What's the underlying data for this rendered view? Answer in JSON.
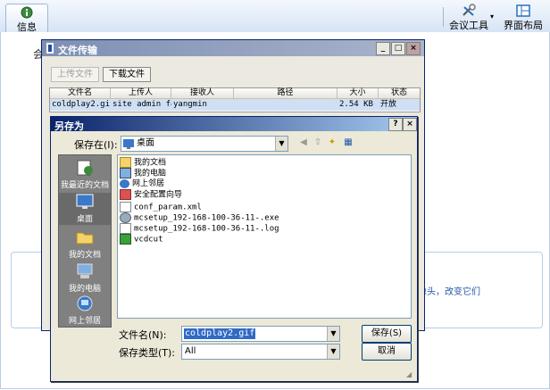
{
  "toolbar": {
    "info_tab": "信息",
    "tools": "会议工具",
    "layout": "界面布局"
  },
  "background": {
    "left_char": "会",
    "right_text": "像头，改变它们"
  },
  "file_transfer": {
    "title": "文件传输",
    "upload_button": "上传文件",
    "download_button": "下载文件",
    "columns": [
      "文件名",
      "上传人",
      "接收人",
      "路径",
      "大小",
      "状态"
    ],
    "rows": [
      [
        "coldplay2.gif",
        "site admin f4",
        "yangmin",
        "",
        "2.54 KB",
        "开放"
      ]
    ]
  },
  "save_dialog": {
    "title": "另存为",
    "help_button": "?",
    "close_button": "×",
    "save_in_label": "保存在(I):",
    "save_in_value": "桌面",
    "places": [
      "我最近的文档",
      "桌面",
      "我的文档",
      "我的电脑",
      "网上邻居"
    ],
    "files": [
      "我的文档",
      "我的电脑",
      "网上邻居",
      "安全配置向导",
      "conf_param.xml",
      "mcsetup_192-168-100-36-11-.exe",
      "mcsetup_192-168-100-36-11-.log",
      "vcdcut"
    ],
    "filename_label": "文件名(N):",
    "filename_value": "coldplay2.gif",
    "filetype_label": "保存类型(T):",
    "filetype_value": "All",
    "save_button": "保存(S)",
    "cancel_button": "取消"
  },
  "colors": {
    "title_active": "#0a246a",
    "selection": "#316ac5",
    "accent": "#2255aa"
  }
}
